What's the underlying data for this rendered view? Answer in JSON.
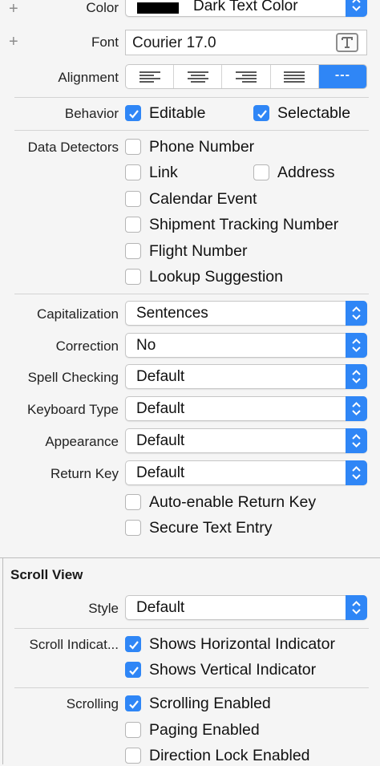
{
  "text_view": {
    "color": {
      "label": "Color",
      "value": "Dark Text Color",
      "swatch": "#000000"
    },
    "font": {
      "label": "Font",
      "value": "Courier 17.0"
    },
    "alignment": {
      "label": "Alignment",
      "options": [
        "align-left",
        "align-center",
        "align-right",
        "align-justified",
        "align-natural"
      ],
      "selected": 4,
      "natural_glyph": "---"
    },
    "behavior": {
      "label": "Behavior",
      "editable": "Editable",
      "selectable": "Selectable"
    },
    "data_detectors": {
      "label": "Data Detectors",
      "phone": "Phone Number",
      "link": "Link",
      "address": "Address",
      "calendar": "Calendar Event",
      "shipment": "Shipment Tracking Number",
      "flight": "Flight Number",
      "lookup": "Lookup Suggestion"
    },
    "capitalization": {
      "label": "Capitalization",
      "value": "Sentences"
    },
    "correction": {
      "label": "Correction",
      "value": "No"
    },
    "spell_checking": {
      "label": "Spell Checking",
      "value": "Default"
    },
    "keyboard_type": {
      "label": "Keyboard Type",
      "value": "Default"
    },
    "appearance": {
      "label": "Appearance",
      "value": "Default"
    },
    "return_key": {
      "label": "Return Key",
      "value": "Default"
    },
    "auto_enable": "Auto-enable Return Key",
    "secure_entry": "Secure Text Entry"
  },
  "scroll_view": {
    "title": "Scroll View",
    "style": {
      "label": "Style",
      "value": "Default"
    },
    "indicators": {
      "label": "Scroll Indicat...",
      "horizontal": "Shows Horizontal Indicator",
      "vertical": "Shows Vertical Indicator"
    },
    "scrolling": {
      "label": "Scrolling",
      "enabled": "Scrolling Enabled",
      "paging": "Paging Enabled",
      "direction_lock": "Direction Lock Enabled"
    }
  },
  "colors": {
    "accent": "#2f86f6",
    "background": "#f5f5f5"
  }
}
